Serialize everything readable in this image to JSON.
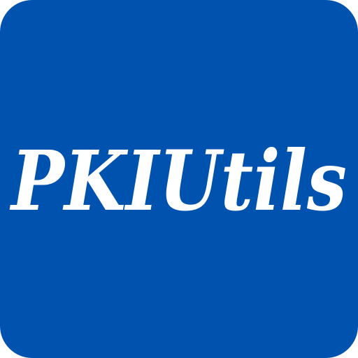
{
  "app": {
    "wordmark": "PKIUtils"
  },
  "colors": {
    "background": "#0052AF",
    "text": "#FFFFFF"
  },
  "icon_name": "pkiutils-logo-icon"
}
